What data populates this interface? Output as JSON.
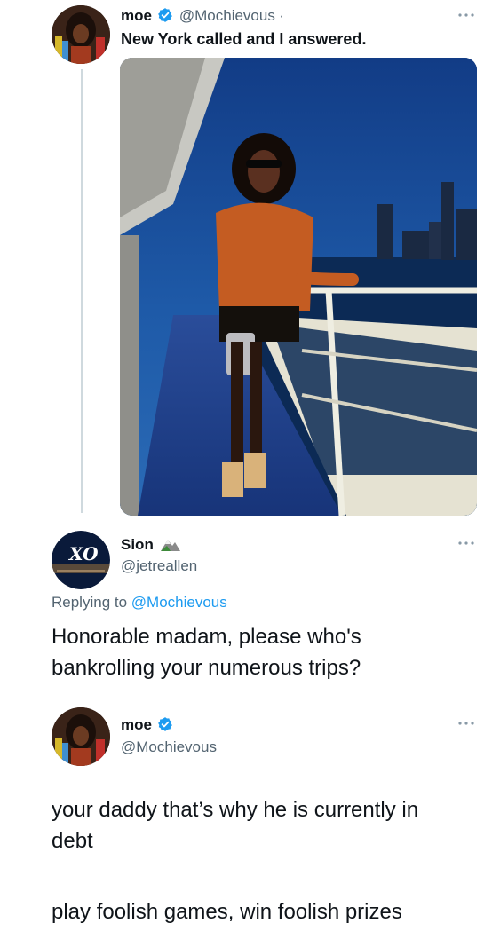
{
  "tweet": {
    "display_name": "moe",
    "handle": "@Mochievous",
    "separator": "·",
    "text": "New York called and I answered."
  },
  "reply": {
    "display_name": "Sion",
    "handle": "@jetreallen",
    "avatar_text": "XO",
    "replying_prefix": "Replying to",
    "replying_to": "@Mochievous",
    "text_line1": "Honorable madam, please who's",
    "text_line2": "bankrolling your numerous trips?"
  },
  "answer": {
    "display_name": "moe",
    "handle": "@Mochievous",
    "text_line1": "your daddy that’s why he is currently in",
    "text_line2": "debt",
    "text_line3": "play foolish games, win foolish prizes"
  },
  "icons": {
    "verified": "verified-badge-icon",
    "more": "more-options-icon",
    "emoji": "mountain-emoji-icon"
  },
  "colors": {
    "verified_blue": "#1d9bf0",
    "mention_blue": "#1d9bf0",
    "secondary_text": "#536471",
    "thread_line": "#cfd9de"
  }
}
